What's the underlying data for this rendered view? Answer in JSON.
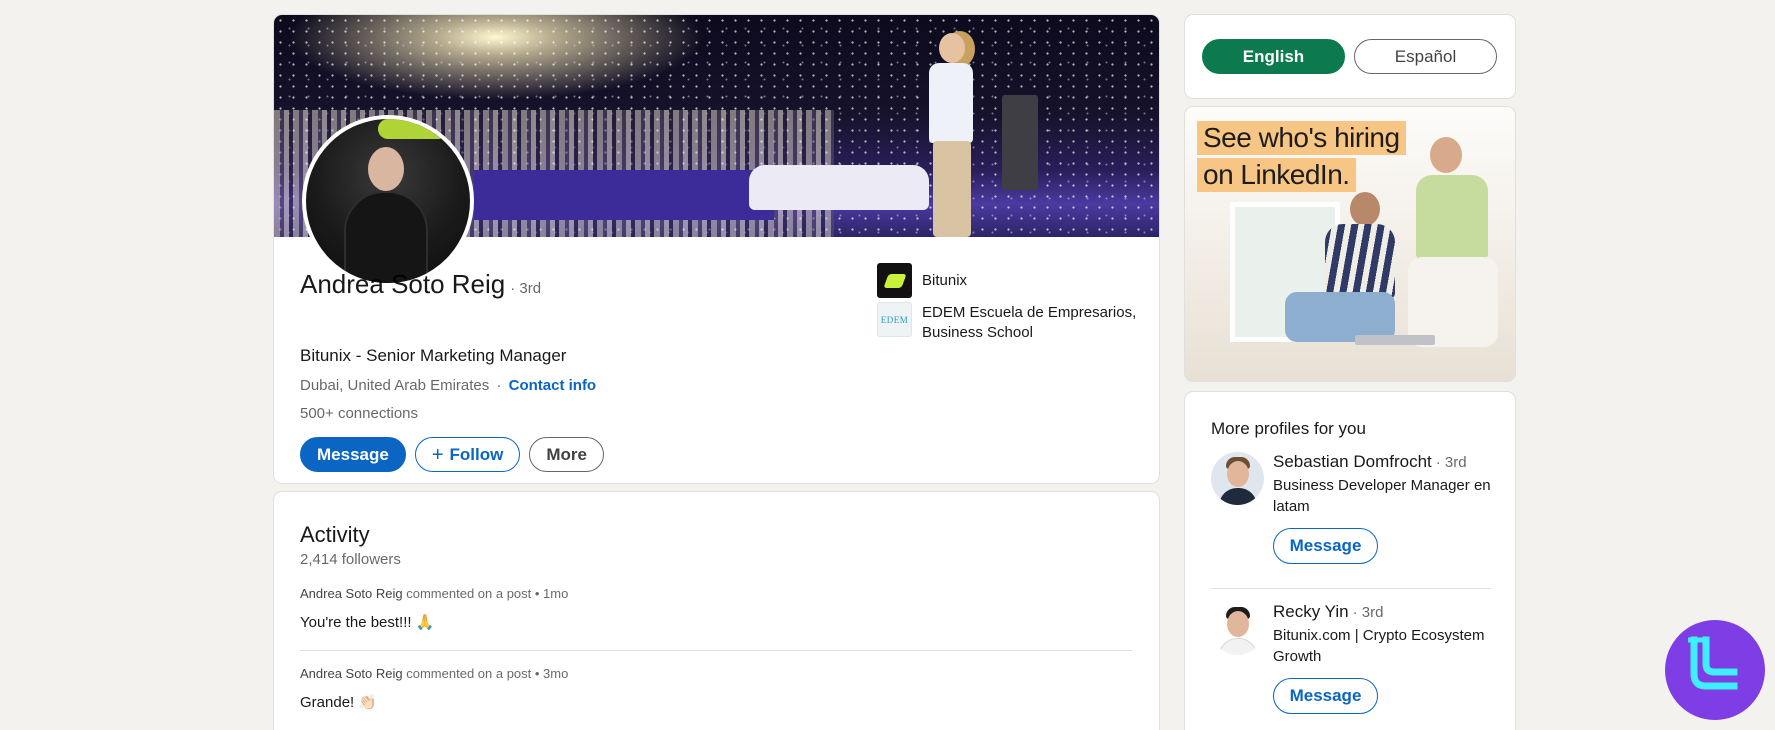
{
  "profile": {
    "name": "Andrea Soto Reig",
    "degree": "· 3rd",
    "headline": "Bitunix - Senior Marketing Manager",
    "location": "Dubai, United Arab Emirates",
    "location_separator": "·",
    "contact_label": "Contact info",
    "connections": "500+ connections",
    "actions": {
      "message": "Message",
      "follow": "Follow",
      "more": "More"
    },
    "organizations": [
      {
        "name": "Bitunix",
        "logo": "bitunix-logo"
      },
      {
        "name": "EDEM Escuela de Empresarios, Business School",
        "logo": "edem-logo",
        "logo_text": "EDEM"
      }
    ]
  },
  "activity": {
    "title": "Activity",
    "followers": "2,414 followers",
    "posts": [
      {
        "author": "Andrea Soto Reig",
        "action": "commented on a post • 1mo",
        "text": "You're the best!!! 🙏"
      },
      {
        "author": "Andrea Soto Reig",
        "action": "commented on a post • 3mo",
        "text": "Grande! 👏🏻"
      }
    ]
  },
  "language": {
    "options": [
      "English",
      "Español"
    ],
    "selected": "English"
  },
  "ad": {
    "line1": "See who's hiring",
    "line2": "on LinkedIn."
  },
  "more_profiles": {
    "title": "More profiles for you",
    "people": [
      {
        "name": "Sebastian Domfrocht",
        "degree": "· 3rd",
        "headline": "Business Developer Manager en latam",
        "button": "Message"
      },
      {
        "name": "Recky Yin",
        "degree": "· 3rd",
        "headline": "Bitunix.com | Crypto Ecosystem Growth",
        "button": "Message"
      }
    ]
  },
  "colors": {
    "primary_blue": "#0a66c2",
    "language_active_green": "#0c7a4e",
    "ad_highlight": "#f7c584",
    "watermark_purple": "#7f3de6"
  }
}
